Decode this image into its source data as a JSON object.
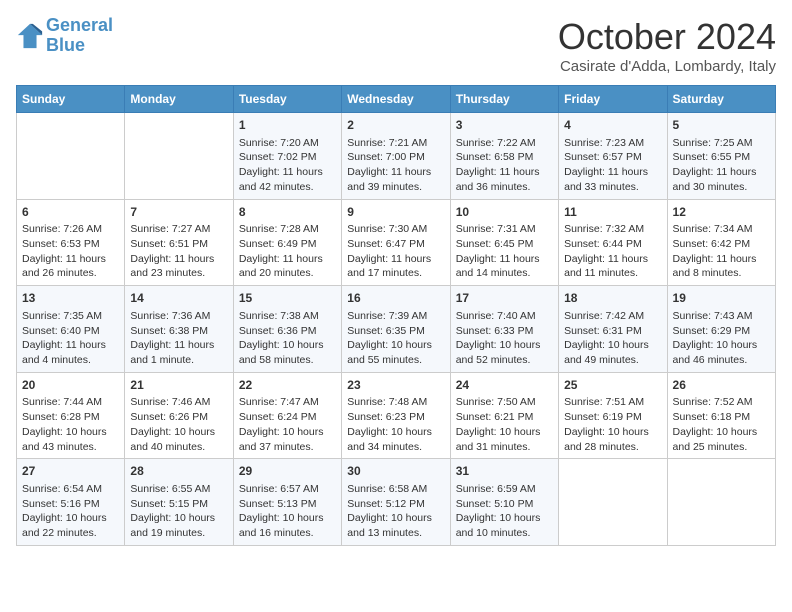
{
  "header": {
    "logo_line1": "General",
    "logo_line2": "Blue",
    "month": "October 2024",
    "location": "Casirate d'Adda, Lombardy, Italy"
  },
  "days_of_week": [
    "Sunday",
    "Monday",
    "Tuesday",
    "Wednesday",
    "Thursday",
    "Friday",
    "Saturday"
  ],
  "weeks": [
    [
      {
        "day": "",
        "info": ""
      },
      {
        "day": "",
        "info": ""
      },
      {
        "day": "1",
        "info": "Sunrise: 7:20 AM\nSunset: 7:02 PM\nDaylight: 11 hours and 42 minutes."
      },
      {
        "day": "2",
        "info": "Sunrise: 7:21 AM\nSunset: 7:00 PM\nDaylight: 11 hours and 39 minutes."
      },
      {
        "day": "3",
        "info": "Sunrise: 7:22 AM\nSunset: 6:58 PM\nDaylight: 11 hours and 36 minutes."
      },
      {
        "day": "4",
        "info": "Sunrise: 7:23 AM\nSunset: 6:57 PM\nDaylight: 11 hours and 33 minutes."
      },
      {
        "day": "5",
        "info": "Sunrise: 7:25 AM\nSunset: 6:55 PM\nDaylight: 11 hours and 30 minutes."
      }
    ],
    [
      {
        "day": "6",
        "info": "Sunrise: 7:26 AM\nSunset: 6:53 PM\nDaylight: 11 hours and 26 minutes."
      },
      {
        "day": "7",
        "info": "Sunrise: 7:27 AM\nSunset: 6:51 PM\nDaylight: 11 hours and 23 minutes."
      },
      {
        "day": "8",
        "info": "Sunrise: 7:28 AM\nSunset: 6:49 PM\nDaylight: 11 hours and 20 minutes."
      },
      {
        "day": "9",
        "info": "Sunrise: 7:30 AM\nSunset: 6:47 PM\nDaylight: 11 hours and 17 minutes."
      },
      {
        "day": "10",
        "info": "Sunrise: 7:31 AM\nSunset: 6:45 PM\nDaylight: 11 hours and 14 minutes."
      },
      {
        "day": "11",
        "info": "Sunrise: 7:32 AM\nSunset: 6:44 PM\nDaylight: 11 hours and 11 minutes."
      },
      {
        "day": "12",
        "info": "Sunrise: 7:34 AM\nSunset: 6:42 PM\nDaylight: 11 hours and 8 minutes."
      }
    ],
    [
      {
        "day": "13",
        "info": "Sunrise: 7:35 AM\nSunset: 6:40 PM\nDaylight: 11 hours and 4 minutes."
      },
      {
        "day": "14",
        "info": "Sunrise: 7:36 AM\nSunset: 6:38 PM\nDaylight: 11 hours and 1 minute."
      },
      {
        "day": "15",
        "info": "Sunrise: 7:38 AM\nSunset: 6:36 PM\nDaylight: 10 hours and 58 minutes."
      },
      {
        "day": "16",
        "info": "Sunrise: 7:39 AM\nSunset: 6:35 PM\nDaylight: 10 hours and 55 minutes."
      },
      {
        "day": "17",
        "info": "Sunrise: 7:40 AM\nSunset: 6:33 PM\nDaylight: 10 hours and 52 minutes."
      },
      {
        "day": "18",
        "info": "Sunrise: 7:42 AM\nSunset: 6:31 PM\nDaylight: 10 hours and 49 minutes."
      },
      {
        "day": "19",
        "info": "Sunrise: 7:43 AM\nSunset: 6:29 PM\nDaylight: 10 hours and 46 minutes."
      }
    ],
    [
      {
        "day": "20",
        "info": "Sunrise: 7:44 AM\nSunset: 6:28 PM\nDaylight: 10 hours and 43 minutes."
      },
      {
        "day": "21",
        "info": "Sunrise: 7:46 AM\nSunset: 6:26 PM\nDaylight: 10 hours and 40 minutes."
      },
      {
        "day": "22",
        "info": "Sunrise: 7:47 AM\nSunset: 6:24 PM\nDaylight: 10 hours and 37 minutes."
      },
      {
        "day": "23",
        "info": "Sunrise: 7:48 AM\nSunset: 6:23 PM\nDaylight: 10 hours and 34 minutes."
      },
      {
        "day": "24",
        "info": "Sunrise: 7:50 AM\nSunset: 6:21 PM\nDaylight: 10 hours and 31 minutes."
      },
      {
        "day": "25",
        "info": "Sunrise: 7:51 AM\nSunset: 6:19 PM\nDaylight: 10 hours and 28 minutes."
      },
      {
        "day": "26",
        "info": "Sunrise: 7:52 AM\nSunset: 6:18 PM\nDaylight: 10 hours and 25 minutes."
      }
    ],
    [
      {
        "day": "27",
        "info": "Sunrise: 6:54 AM\nSunset: 5:16 PM\nDaylight: 10 hours and 22 minutes."
      },
      {
        "day": "28",
        "info": "Sunrise: 6:55 AM\nSunset: 5:15 PM\nDaylight: 10 hours and 19 minutes."
      },
      {
        "day": "29",
        "info": "Sunrise: 6:57 AM\nSunset: 5:13 PM\nDaylight: 10 hours and 16 minutes."
      },
      {
        "day": "30",
        "info": "Sunrise: 6:58 AM\nSunset: 5:12 PM\nDaylight: 10 hours and 13 minutes."
      },
      {
        "day": "31",
        "info": "Sunrise: 6:59 AM\nSunset: 5:10 PM\nDaylight: 10 hours and 10 minutes."
      },
      {
        "day": "",
        "info": ""
      },
      {
        "day": "",
        "info": ""
      }
    ]
  ]
}
